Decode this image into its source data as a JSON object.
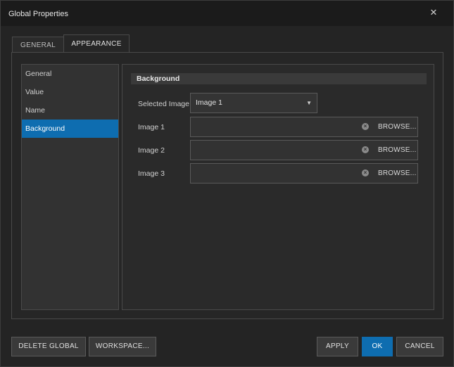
{
  "window": {
    "title": "Global Properties",
    "close_glyph": "✕"
  },
  "tabs": [
    {
      "label": "GENERAL",
      "active": false
    },
    {
      "label": "APPEARANCE",
      "active": true
    }
  ],
  "nav": {
    "items": [
      {
        "label": "General",
        "active": false
      },
      {
        "label": "Value",
        "active": false
      },
      {
        "label": "Name",
        "active": false
      },
      {
        "label": "Background",
        "active": true
      }
    ]
  },
  "background": {
    "section_title": "Background",
    "selected_image_label": "Selected Image",
    "selected_image_value": "Image 1",
    "images": [
      {
        "label": "Image 1",
        "value": "",
        "browse_label": "BROWSE..."
      },
      {
        "label": "Image 2",
        "value": "",
        "browse_label": "BROWSE..."
      },
      {
        "label": "Image 3",
        "value": "",
        "browse_label": "BROWSE..."
      }
    ]
  },
  "footer": {
    "delete_global": "DELETE GLOBAL",
    "workspace": "WORKSPACE...",
    "apply": "APPLY",
    "ok": "OK",
    "cancel": "CANCEL"
  },
  "colors": {
    "accent": "#0e6db0",
    "background": "#242424",
    "panel": "#2a2a2a"
  },
  "icons": {
    "close": "close-icon",
    "dropdown": "caret-down-icon",
    "clear": "clear-icon"
  }
}
